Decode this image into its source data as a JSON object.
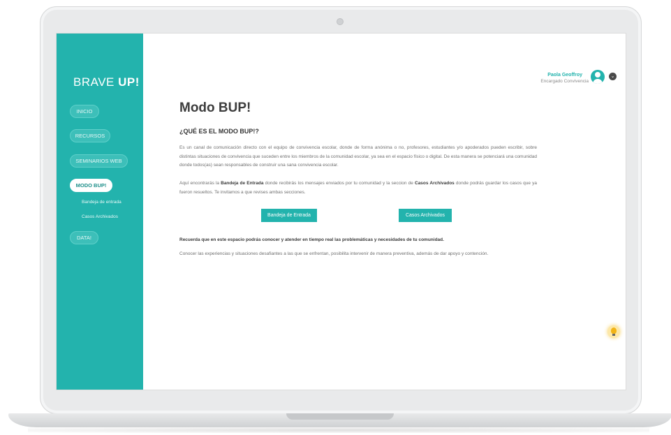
{
  "app": {
    "logo_light": "BRAVE ",
    "logo_bold": "UP!"
  },
  "sidebar": {
    "items": [
      {
        "label": "INICIO"
      },
      {
        "label": "RECURSOS"
      },
      {
        "label": "SEMINARIOS WEB"
      },
      {
        "label": "MODO BUP!",
        "active": true
      },
      {
        "label": "DATA!"
      }
    ],
    "subitems": [
      {
        "label": "Bandeja de entrada"
      },
      {
        "label": "Casos Archivados"
      }
    ]
  },
  "user": {
    "name": "Paola Geoffroy",
    "role": "Encargado Convivencia",
    "avatar_icon": "user-avatar-icon",
    "menu_icon": "chevron-down-icon"
  },
  "main": {
    "title": "Modo BUP!",
    "subtitle": "¿QUÉ ES EL MODO BUP!?",
    "intro": "Es un canal de comunicación directo con el equipo de convivencia escolar, donde de forma anónima o no, profesores, estudiantes y/o apoderados pueden escribir, sobre distintas situaciones de convivencia que suceden entre los miembros de la comunidad escolar, ya sea en el espacio físico o digital. De esta manera se potenciará una comunidad donde todos(as) sean responsables de construir una sana convivencia escolar.",
    "inbox_text": {
      "part1": "Aquí encontrarás la ",
      "bold1": "Bandeja de Entrada",
      "part2": " donde recibirás los mensajes enviados por tu comunidad y la seccion de ",
      "bold2": "Casos Archivados",
      "part3": " donde podrás guardar los casos que ya fueron resueltos. Te invitamos a que revises ambas secciones."
    },
    "buttons": {
      "inbox": "Bandeja de Entrada",
      "archived": "Casos Archivados"
    },
    "reminder": "Recuerda que en este espacio podrás conocer y atender en tiempo real las problemáticas y necesidades de tu comunidad.",
    "note": "Conocer las experiencias y situaciones desafiantes a las que se enfrentan, posibilita intervenir de manera preventiva, además de dar apoyo y contención.",
    "help_icon": "lightbulb-icon"
  },
  "colors": {
    "accent": "#23b3ad",
    "text_dark": "#3d3d3d",
    "text_muted": "#6f6f6f"
  }
}
